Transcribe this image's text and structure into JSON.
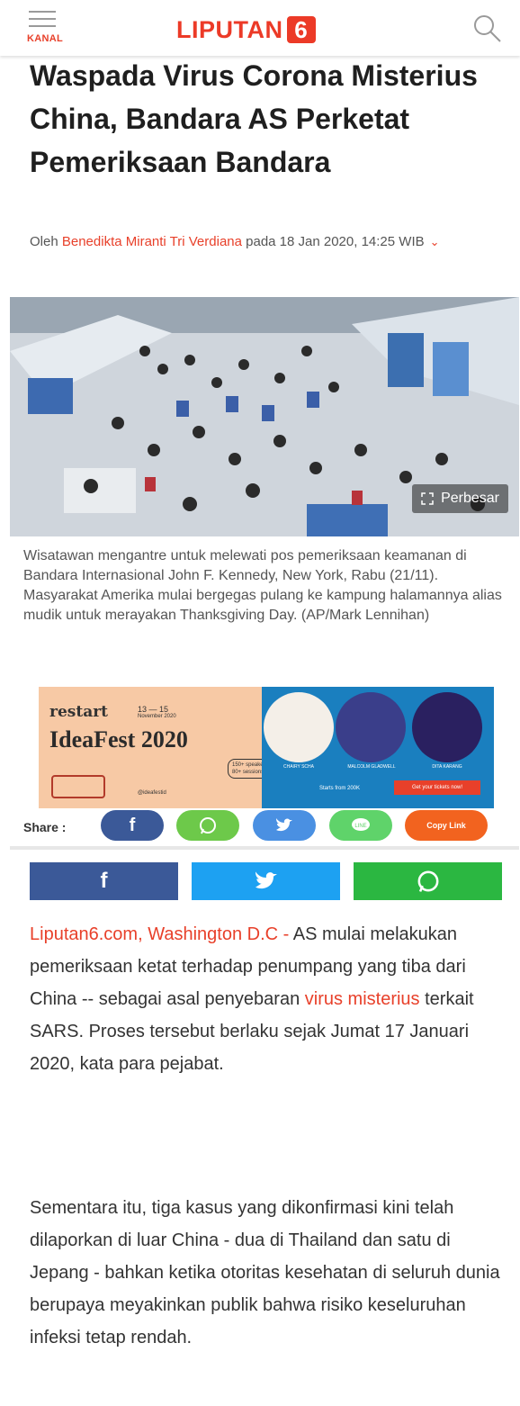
{
  "header": {
    "menu_label": "KANAL",
    "logo_text": "LIPUTAN",
    "logo_number": "6",
    "brand_color": "#ec3a27",
    "icons": [
      "menu-icon",
      "search-icon"
    ]
  },
  "article": {
    "title": "Waspada Virus Corona Misterius China, Bandara AS Perketat Pemeriksaan Bandara",
    "byline_prefix": "Oleh ",
    "author": "Benedikta Miranti Tri Verdiana",
    "byline_date": " pada 18 Jan 2020, 14:25 WIB",
    "image_button": "Perbesar",
    "caption": "Wisatawan mengantre untuk melewati pos pemeriksaan keamanan di Bandara Internasional John F. Kennedy, New York, Rabu (21/11). Masyarakat Amerika mulai bergegas pulang ke kampung halamannya alias mudik untuk merayakan Thanksgiving Day. (AP/Mark Lennihan)"
  },
  "ad": {
    "brand": "restart",
    "date_range": "13 — 15",
    "date_sub": "November 2020",
    "event": "IdeaFest 2020",
    "stats": "150+ speakers 80+ sessions",
    "handle": "@ideafestid",
    "speakers": [
      "CHAIRY SCHA",
      "MALCOLM GLADWELL",
      "DITA KARANG"
    ],
    "starts": "Starts from 200K",
    "cta": "Get your tickets now!"
  },
  "share": {
    "label": "Share :",
    "buttons": [
      {
        "name": "facebook",
        "color": "#3b5998"
      },
      {
        "name": "whatsapp",
        "color": "#6dc94a"
      },
      {
        "name": "twitter",
        "color": "#4a90e2"
      },
      {
        "name": "line",
        "color": "#5fd36a"
      },
      {
        "name": "copy",
        "label": "Copy Link",
        "color": "#f2631f"
      }
    ],
    "bar": [
      {
        "name": "facebook",
        "color": "#3b5998"
      },
      {
        "name": "twitter",
        "color": "#1da1f2"
      },
      {
        "name": "whatsapp",
        "color": "#2bb741"
      }
    ]
  },
  "body": {
    "p1_dateline": "Liputan6.com, Washington D.C - ",
    "p1_a": "AS mulai melakukan pemeriksaan ketat terhadap penumpang yang tiba dari China -- sebagai asal penyebaran ",
    "p1_link": "virus misterius",
    "p1_b": " terkait SARS. Proses tersebut berlaku sejak Jumat 17 Januari 2020, kata para pejabat.",
    "p2": "Sementara itu, tiga kasus yang dikonfirmasi kini telah dilaporkan di luar China - dua di Thailand dan satu di Jepang - bahkan ketika otoritas kesehatan di seluruh dunia berupaya meyakinkan publik bahwa risiko keseluruhan infeksi tetap rendah."
  }
}
